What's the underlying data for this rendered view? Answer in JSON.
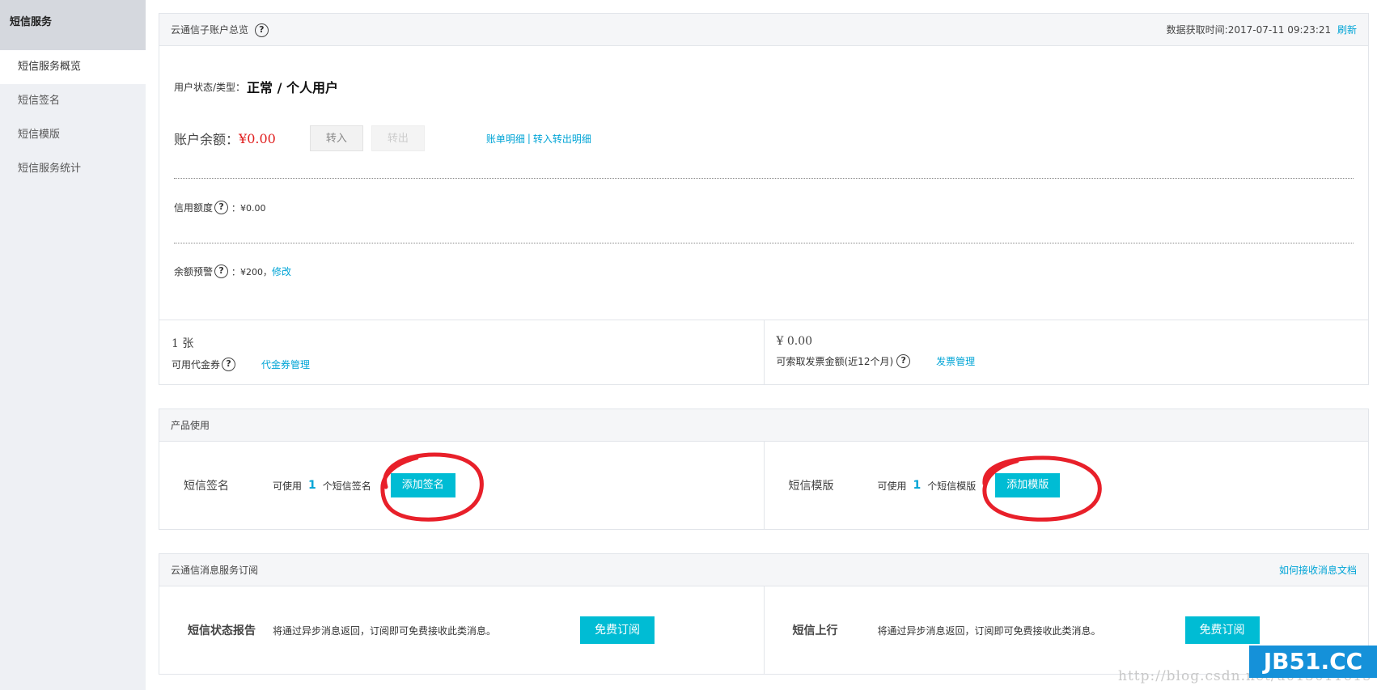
{
  "sidebar": {
    "title": "短信服务",
    "items": [
      {
        "label": "短信服务概览"
      },
      {
        "label": "短信签名"
      },
      {
        "label": "短信模版"
      },
      {
        "label": "短信服务统计"
      }
    ]
  },
  "account": {
    "title": "云通信子账户总览",
    "fetch_time": "数据获取时间:2017-07-11 09:23:21",
    "refresh": "刷新",
    "status_label": "用户状态/类型：",
    "status_value": "正常 / 个人用户",
    "balance_label": "账户余额：",
    "balance_value": "¥0.00",
    "transfer_in": "转入",
    "transfer_out": "转出",
    "bill_detail": "账单明细",
    "separator": "|",
    "transfer_detail": "转入转出明细",
    "credit_label": "信用额度",
    "credit_value": "：¥0.00",
    "alert_label": "余额预警",
    "alert_value": "：¥200，",
    "alert_edit": "修改",
    "voucher_count": "1 张",
    "voucher_label": "可用代金券",
    "voucher_manage": "代金券管理",
    "invoice_amount": "¥ 0.00",
    "invoice_label": "可索取发票金额(近12个月)",
    "invoice_manage": "发票管理"
  },
  "product": {
    "title": "产品使用",
    "items": [
      {
        "name": "短信签名",
        "prefix": "可使用",
        "count": "1",
        "suffix": "个短信签名",
        "button": "添加签名"
      },
      {
        "name": "短信模版",
        "prefix": "可使用",
        "count": "1",
        "suffix": "个短信模版",
        "button": "添加模版"
      }
    ]
  },
  "subscribe": {
    "title": "云通信消息服务订阅",
    "doc_link": "如何接收消息文档",
    "items": [
      {
        "name": "短信状态报告",
        "desc": "将通过异步消息返回，订阅即可免费接收此类消息。",
        "button": "免费订阅"
      },
      {
        "name": "短信上行",
        "desc": "将通过异步消息返回，订阅即可免费接收此类消息。",
        "button": "免费订阅"
      }
    ]
  },
  "help_icon": "?",
  "watermark": {
    "url": "http://blog.csdn.net/u013011615",
    "logo": "JB51.CC"
  },
  "colors": {
    "accent": "#00a4d6",
    "button": "#00bcd4",
    "danger": "#e01f1f",
    "annotation": "#e8202a"
  }
}
